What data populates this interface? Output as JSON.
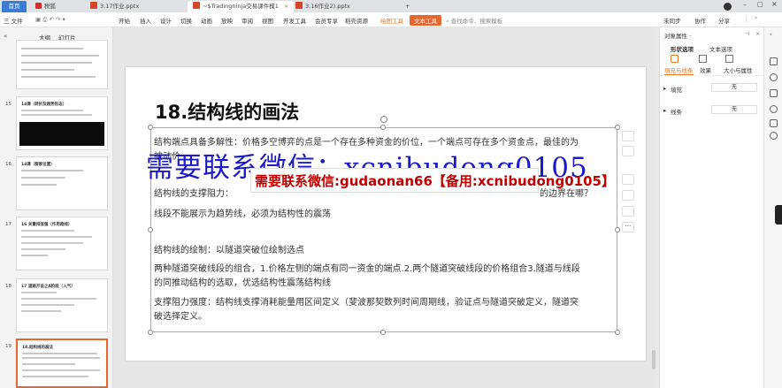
{
  "tabs": {
    "home": "首页",
    "wps": "税狐",
    "t1": "3.17作业.pptx",
    "t2": "~$Tradingninja交易课件模1",
    "t3": "3.16作业2).pptx"
  },
  "menu": {
    "file": "三 文件",
    "start": "开始",
    "insert": "插入",
    "design": "设计",
    "transition": "切换",
    "animation": "动画",
    "slideshow": "放映",
    "review": "审阅",
    "view": "视图",
    "devtools": "开发工具",
    "member": "会员专享",
    "resources": "稻壳资源",
    "drawtools": "绘图工具",
    "texttools": "文本工具",
    "search": "查找命令、搜索模板",
    "unsynced": "未同步",
    "collab": "协作",
    "share": "分享"
  },
  "left_panel": {
    "tab_outline": "大纲",
    "tab_slides": "幻灯片",
    "thumbs": [
      {
        "num": "",
        "title": ""
      },
      {
        "num": "15",
        "title": "14课（转折及趋势形态）"
      },
      {
        "num": "16",
        "title": "14课（群家位置）"
      },
      {
        "num": "17",
        "title": "16 关重排涨强（作用趋线）"
      },
      {
        "num": "18",
        "title": "17 道路开设之A阶段（入气）"
      },
      {
        "num": "19",
        "title": "18.结构线的画法"
      }
    ]
  },
  "slide": {
    "title": "18.结构线的画法",
    "lines": [
      "结构端点具备多解性：价格多空博弈的点是一个存在多种资金的价位，一个端点可存在多个资金点，最佳的为",
      "被动价",
      "结构线的支撑阻力：",
      "线段不能展示为趋势线，必须为结构性的震荡",
      "结构线的绘制：以隧道突破位绘制选点",
      "两种隧道突破线段的组合，1.价格左侧的端点有同一资金的端点.2.两个隧道突破线段的价格组合3.隧道与线段",
      "的同推动结构的选取，优选结构性震荡结构线",
      "支撑阻力强度：结构线支撑消耗能量用区间定义（斐波那契数列时间周期线，验证点与隧道突破定义，隧道突",
      "破选择定义。"
    ],
    "fragment": "的边界在哪？"
  },
  "watermark": {
    "main": "需要联系微信：xcnibudong0105",
    "box": "需要联系微信:gudaonan66【备用:xcnibudong0105】"
  },
  "right_panel": {
    "title": "对象属性 ·",
    "tab1": "形状选项",
    "tab2": "文本选项",
    "sub1": "填充与线条",
    "sub2": "效果",
    "sub3": "大小与属性",
    "fill_label": "填充",
    "fill_value": "无",
    "line_label": "线条",
    "line_value": "无"
  }
}
